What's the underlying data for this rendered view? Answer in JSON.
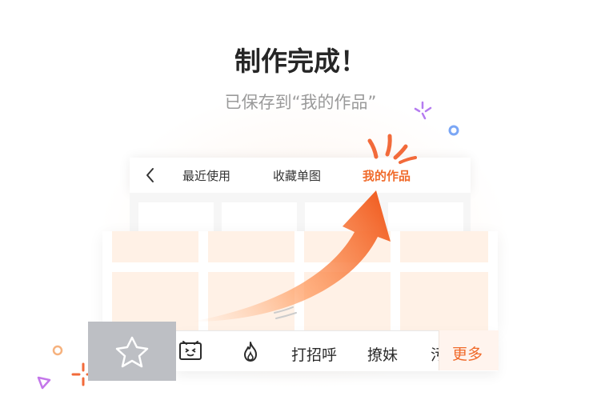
{
  "header": {
    "title": "制作完成！",
    "subtitle": "已保存到“我的作品”"
  },
  "panel": {
    "tabs": [
      {
        "label": "最近使用"
      },
      {
        "label": "收藏单图"
      },
      {
        "label": "我的作品",
        "active": true
      }
    ]
  },
  "toolbar": {
    "items": [
      {
        "icon": "star-icon",
        "selected": true
      },
      {
        "icon": "emoji-face-icon"
      },
      {
        "icon": "fire-icon"
      },
      {
        "label": "打招呼"
      },
      {
        "label": "撩妹"
      },
      {
        "label": "污"
      }
    ],
    "more_label": "更多"
  },
  "colors": {
    "accent": "#f06a2a",
    "cell_placeholder": "#fff1e6",
    "selected_tile": "#bdbfc4"
  }
}
